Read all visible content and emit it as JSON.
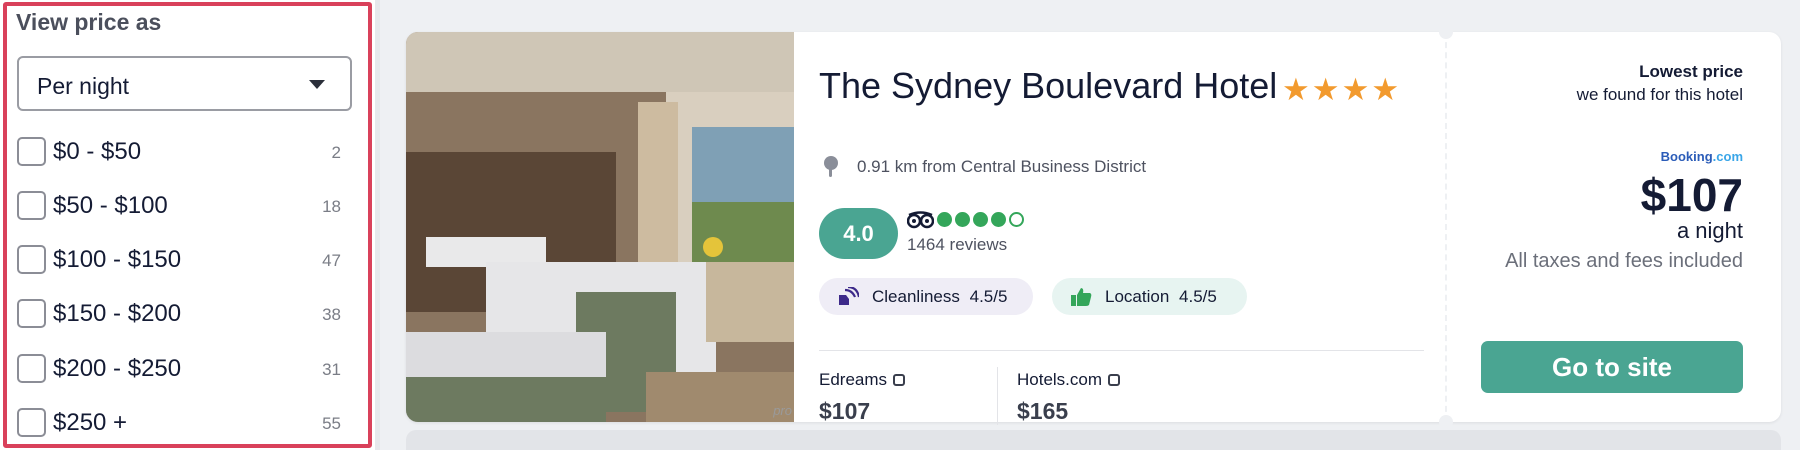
{
  "filter": {
    "title": "View price as",
    "select_value": "Per night",
    "ranges": [
      {
        "label": "$0 - $50",
        "count": "2"
      },
      {
        "label": "$50 - $100",
        "count": "18"
      },
      {
        "label": "$100 - $150",
        "count": "47"
      },
      {
        "label": "$150 - $200",
        "count": "38"
      },
      {
        "label": "$200 - $250",
        "count": "31"
      },
      {
        "label": "$250 +",
        "count": "55"
      }
    ]
  },
  "hotel": {
    "photo_credit": "pro",
    "name": "The Sydney Boulevard Hotel",
    "star_rating": 4,
    "location": "0.91 km from Central Business District",
    "rating": "4.0",
    "tripadvisor_bubbles": 4,
    "reviews": "1464 reviews",
    "cleanliness_label": "Cleanliness",
    "cleanliness_score": "4.5/5",
    "location_label": "Location",
    "location_score": "4.5/5",
    "providers": [
      {
        "name": "Edreams",
        "price": "$107"
      },
      {
        "name": "Hotels.com",
        "price": "$165"
      }
    ]
  },
  "deal": {
    "title": "Lowest price",
    "subtitle": "we found for this hotel",
    "logo_main": "Booking",
    "logo_suffix": ".com",
    "price": "$107",
    "per": "a night",
    "taxes": "All taxes and fees included",
    "button": "Go to site"
  },
  "colors": {
    "accent": "#4aa592",
    "highlight": "#d9415b",
    "star": "#f29a2e",
    "tripadvisor": "#34a65a"
  }
}
